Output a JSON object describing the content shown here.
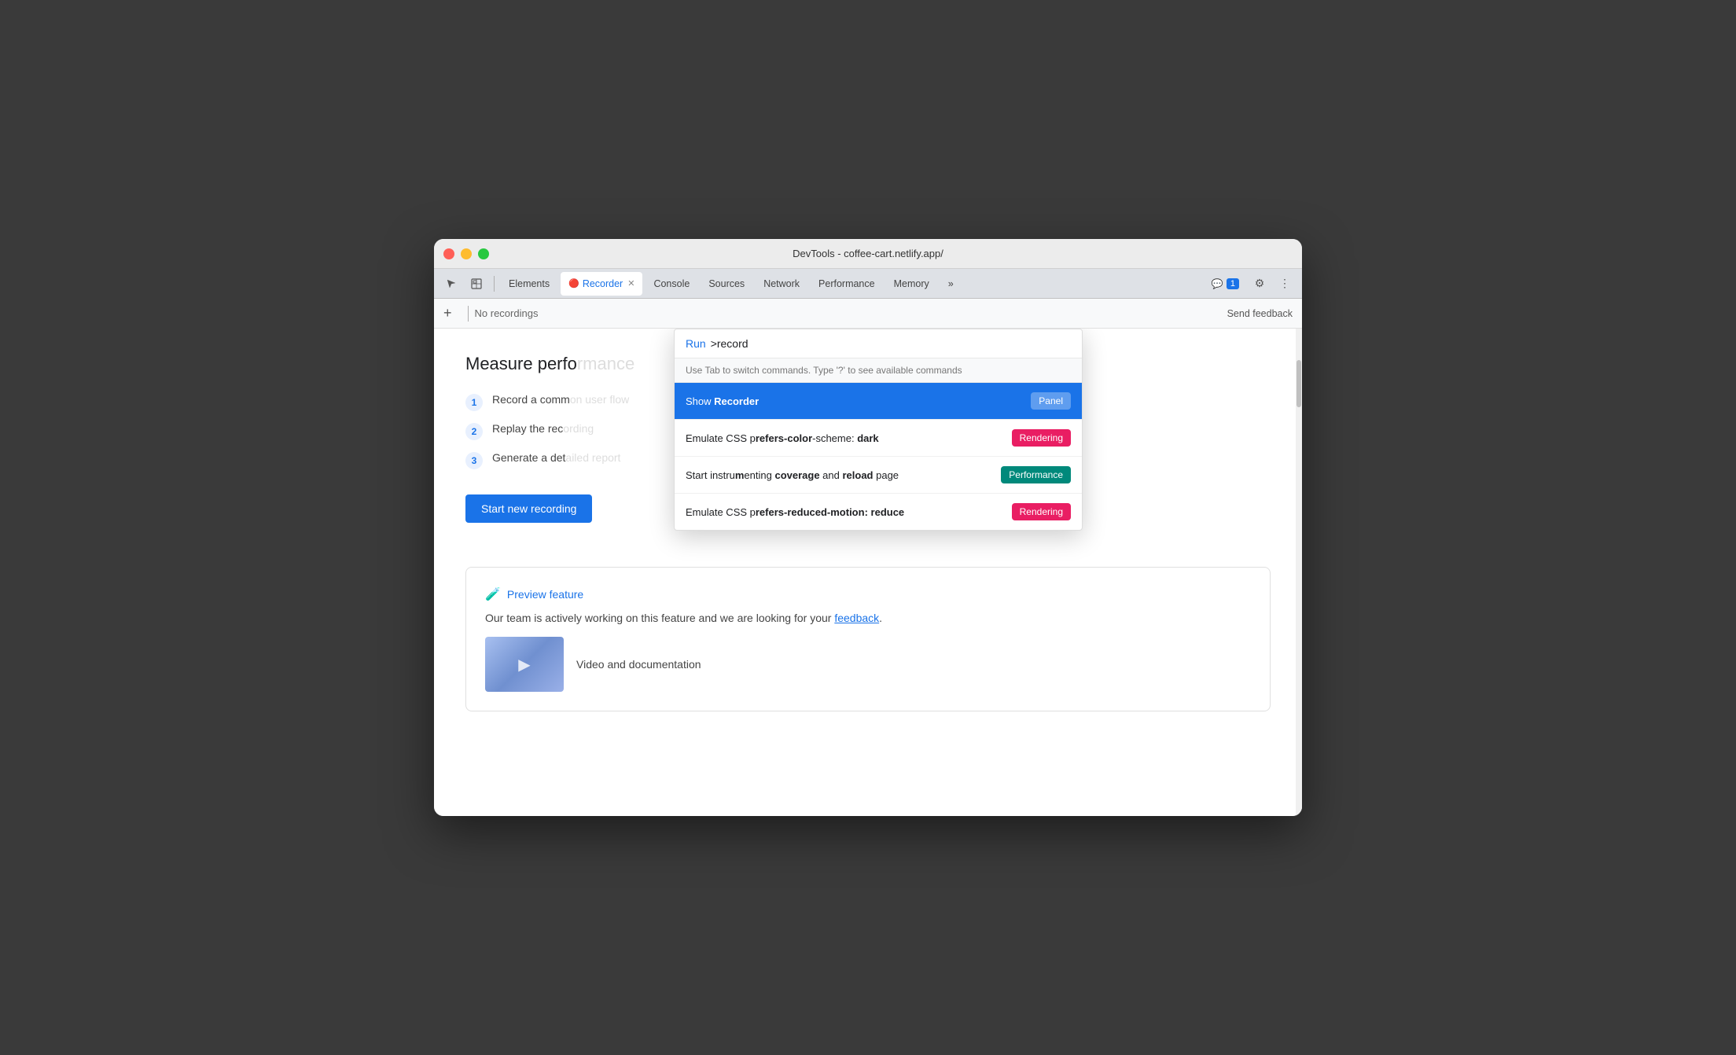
{
  "window": {
    "title": "DevTools - coffee-cart.netlify.app/"
  },
  "titlebar": {
    "title": "DevTools - coffee-cart.netlify.app/"
  },
  "traffic_lights": {
    "close": "close",
    "minimize": "minimize",
    "maximize": "maximize"
  },
  "tabs": [
    {
      "id": "cursor",
      "label": "",
      "icon": "↖",
      "active": false,
      "closable": false
    },
    {
      "id": "inspect",
      "label": "",
      "icon": "⬚",
      "active": false,
      "closable": false
    },
    {
      "id": "elements",
      "label": "Elements",
      "active": false,
      "closable": false
    },
    {
      "id": "recorder",
      "label": "Recorder",
      "active": true,
      "closable": true,
      "has_icon": true
    },
    {
      "id": "console",
      "label": "Console",
      "active": false,
      "closable": false
    },
    {
      "id": "sources",
      "label": "Sources",
      "active": false,
      "closable": false
    },
    {
      "id": "network",
      "label": "Network",
      "active": false,
      "closable": false
    },
    {
      "id": "performance",
      "label": "Performance",
      "active": false,
      "closable": false
    },
    {
      "id": "memory",
      "label": "Memory",
      "active": false,
      "closable": false
    },
    {
      "id": "more",
      "label": "»",
      "active": false,
      "closable": false
    }
  ],
  "toolbar_right": {
    "feedback_icon": "💬",
    "feedback_count": "1",
    "settings_icon": "⚙",
    "more_icon": "⋮"
  },
  "recorder_header": {
    "add_icon": "+",
    "no_recordings_label": "No recordings",
    "send_feedback_label": "Send feedback"
  },
  "main_content": {
    "measure_title": "Measure perfo",
    "steps": [
      {
        "number": "1",
        "text": "Record a comr"
      },
      {
        "number": "2",
        "text": "Replay the rec"
      },
      {
        "number": "3",
        "text": "Generate a det"
      }
    ],
    "start_recording_btn": "Start new recording",
    "preview_card": {
      "icon": "🧪",
      "title": "Preview feature",
      "description": "Our team is actively working on this feature and we are looking for your",
      "feedback_link": "feedback",
      "description_end": ".",
      "video_label": "Video and documentation"
    }
  },
  "command_palette": {
    "run_label": "Run",
    "input_text": ">record",
    "hint": "Use Tab to switch commands. Type '?' to see available commands",
    "items": [
      {
        "id": "show-recorder",
        "text_parts": [
          "Show ",
          "Recorder"
        ],
        "bold_parts": [
          "Recorder"
        ],
        "badge_label": "Panel",
        "badge_color": "blue",
        "highlighted": true
      },
      {
        "id": "css-dark",
        "text_parts": [
          "Emulate CSS p",
          "refers-color",
          "-scheme: ",
          "dark"
        ],
        "bold_parts": [
          "refers-color",
          "dark"
        ],
        "badge_label": "Rendering",
        "badge_color": "pink",
        "highlighted": false
      },
      {
        "id": "coverage",
        "text_parts": [
          "Start instru",
          "m",
          "enting ",
          "coverage",
          " and ",
          "reload",
          " page"
        ],
        "bold_parts": [
          "m",
          "coverage",
          "reload"
        ],
        "badge_label": "Performance",
        "badge_color": "teal",
        "highlighted": false
      },
      {
        "id": "css-reduce",
        "text_parts": [
          "Emulate CSS p",
          "refers-reduced-motion: ",
          "reduce"
        ],
        "bold_parts": [
          "refers-reduced-motion:",
          "reduce"
        ],
        "badge_label": "Rendering",
        "badge_color": "pink",
        "highlighted": false
      }
    ]
  }
}
